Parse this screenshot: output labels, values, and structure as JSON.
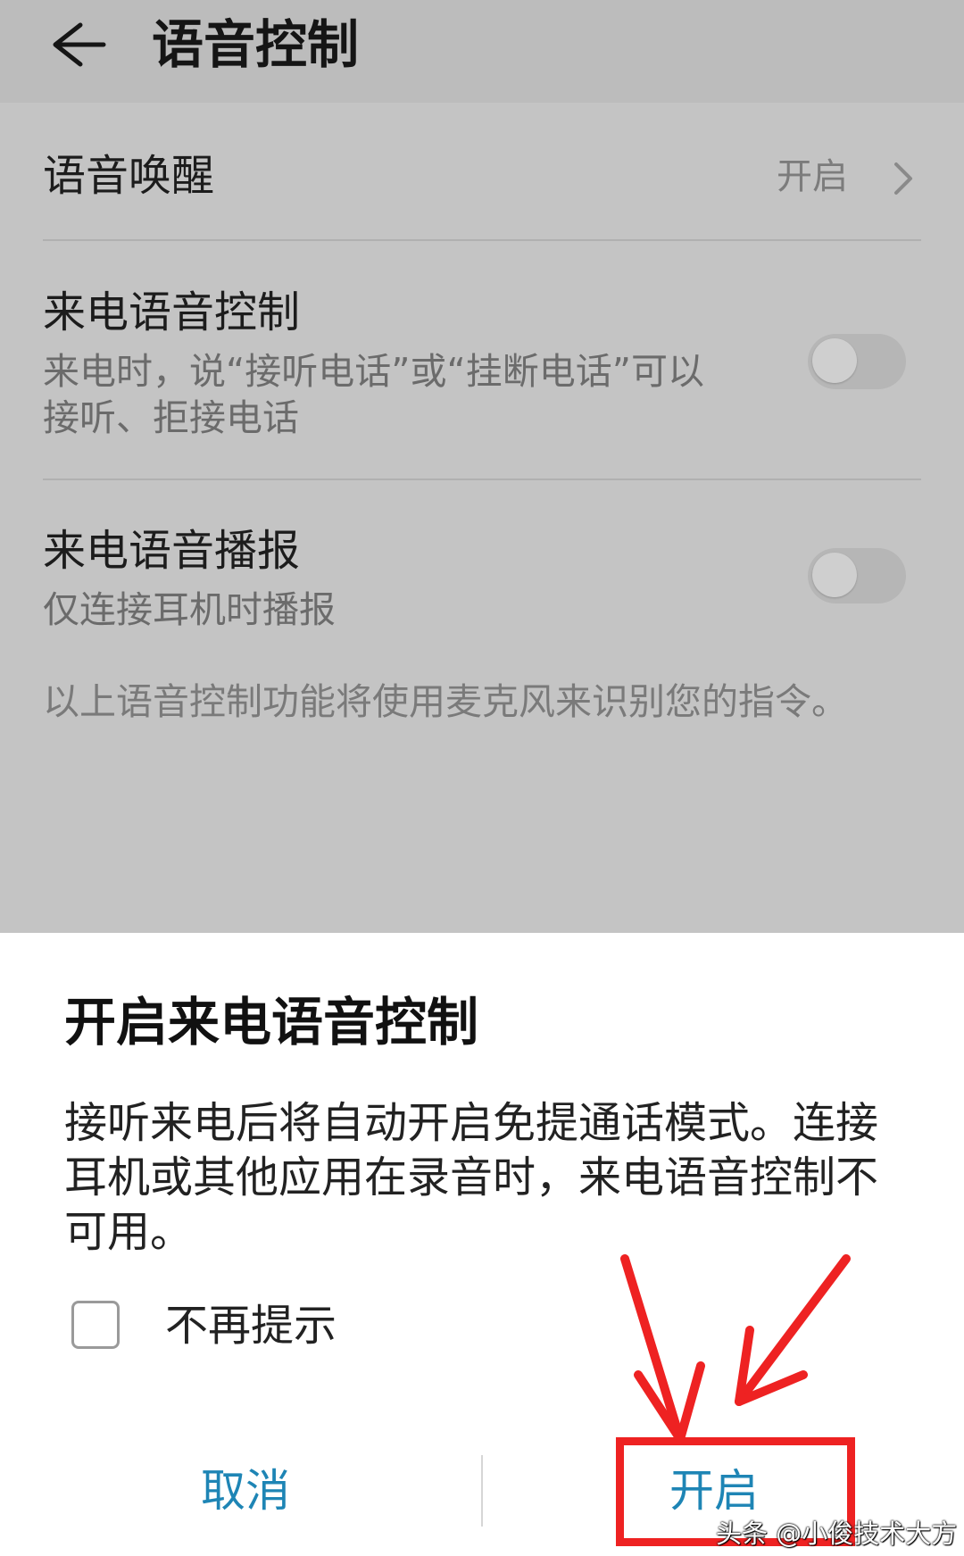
{
  "header": {
    "title": "语音控制"
  },
  "settings": {
    "wake": {
      "title": "语音唤醒",
      "value": "开启"
    },
    "call_control": {
      "title": "来电语音控制",
      "subtitle": "来电时，说“接听电话”或“挂断电话”可以接听、拒接电话",
      "enabled": false
    },
    "call_announce": {
      "title": "来电语音播报",
      "subtitle": "仅连接耳机时播报",
      "enabled": false
    },
    "note": "以上语音控制功能将使用麦克风来识别您的指令。"
  },
  "dialog": {
    "title": "开启来电语音控制",
    "body": "接听来电后将自动开启免提通话模式。连接耳机或其他应用在录音时，来电语音控制不可用。",
    "checkbox_label": "不再提示",
    "checkbox_checked": false,
    "cancel_label": "取消",
    "ok_label": "开启",
    "button_color": "#1e85b5"
  },
  "annotation": {
    "color": "#ee2222"
  },
  "watermark": "头条 @小俊技术大方"
}
